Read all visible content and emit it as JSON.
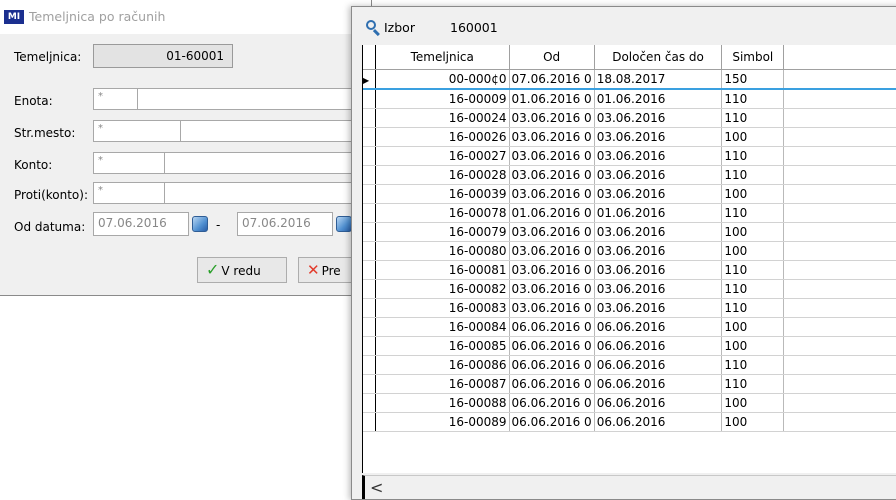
{
  "dialog": {
    "logo_text": "MI",
    "title": "Temeljnica po računih",
    "temeljnica_label": "Temeljnica:",
    "temeljnica_value": "01-60001",
    "enota_label": "Enota:",
    "strmesto_label": "Str.mesto:",
    "konto_label": "Konto:",
    "proti_label": "Proti(konto):",
    "od_datuma_label": "Od datuma:",
    "wildcard": "*",
    "date_from": "07.06.2016",
    "date_sep": "-",
    "date_to": "07.06.2016",
    "ok_label": "V redu",
    "cancel_label": "Pre"
  },
  "picker": {
    "title": "Izbor",
    "number": "160001",
    "columns": [
      "Temeljnica",
      "Od",
      "Določen čas do",
      "Simbol"
    ],
    "rows": [
      [
        "00-000¢0",
        "07.06.2016 0",
        "18.08.2017",
        "150"
      ],
      [
        "16-00009",
        "01.06.2016 0",
        "01.06.2016",
        "110"
      ],
      [
        "16-00024",
        "03.06.2016 0",
        "03.06.2016",
        "110"
      ],
      [
        "16-00026",
        "03.06.2016 0",
        "03.06.2016",
        "100"
      ],
      [
        "16-00027",
        "03.06.2016 0",
        "03.06.2016",
        "110"
      ],
      [
        "16-00028",
        "03.06.2016 0",
        "03.06.2016",
        "110"
      ],
      [
        "16-00039",
        "03.06.2016 0",
        "03.06.2016",
        "100"
      ],
      [
        "16-00078",
        "01.06.2016 0",
        "01.06.2016",
        "110"
      ],
      [
        "16-00079",
        "03.06.2016 0",
        "03.06.2016",
        "100"
      ],
      [
        "16-00080",
        "03.06.2016 0",
        "03.06.2016",
        "100"
      ],
      [
        "16-00081",
        "03.06.2016 0",
        "03.06.2016",
        "110"
      ],
      [
        "16-00082",
        "03.06.2016 0",
        "03.06.2016",
        "110"
      ],
      [
        "16-00083",
        "03.06.2016 0",
        "03.06.2016",
        "110"
      ],
      [
        "16-00084",
        "06.06.2016 0",
        "06.06.2016",
        "100"
      ],
      [
        "16-00085",
        "06.06.2016 0",
        "06.06.2016",
        "100"
      ],
      [
        "16-00086",
        "06.06.2016 0",
        "06.06.2016",
        "110"
      ],
      [
        "16-00087",
        "06.06.2016 0",
        "06.06.2016",
        "110"
      ],
      [
        "16-00088",
        "06.06.2016 0",
        "06.06.2016",
        "100"
      ],
      [
        "16-00089",
        "06.06.2016 0",
        "06.06.2016",
        "100"
      ]
    ],
    "row_indicator": "▶",
    "scroll_left": "<"
  }
}
